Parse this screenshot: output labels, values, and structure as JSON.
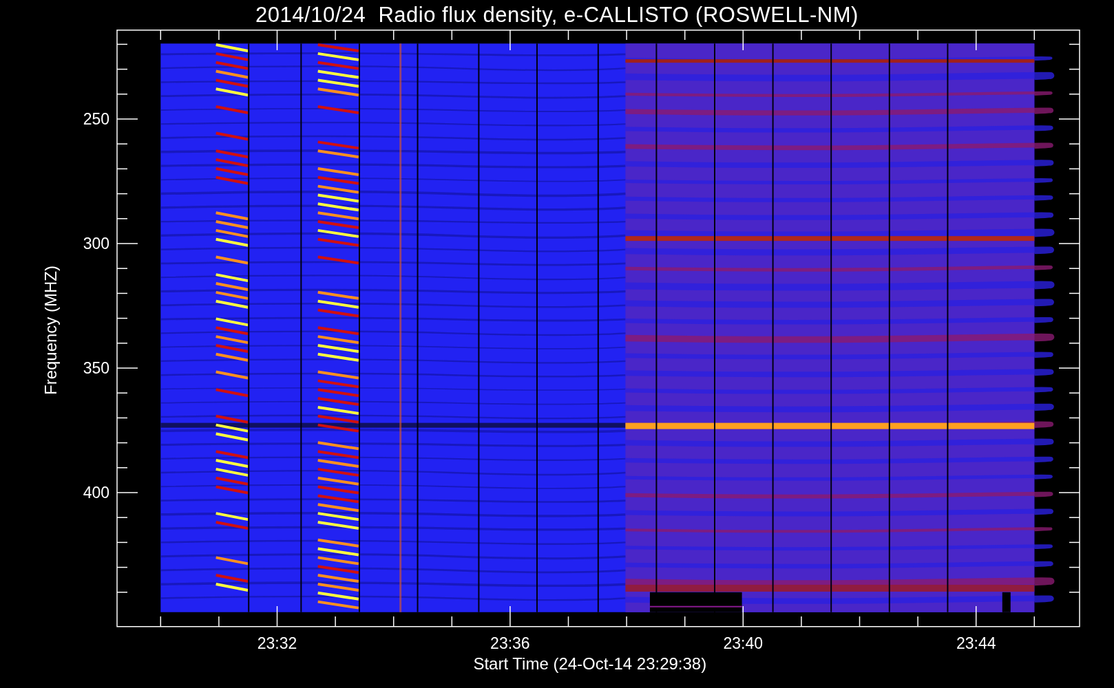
{
  "title": "2014/10/24  Radio flux density, e-CALLISTO (ROSWELL-NM)",
  "y_axis": {
    "label": "Frequency (MHZ)",
    "ticks": [
      "250",
      "300",
      "350",
      "400"
    ]
  },
  "x_axis": {
    "label": "Start Time (24-Oct-14 23:29:38)",
    "ticks": [
      "23:32",
      "23:36",
      "23:40",
      "23:44"
    ]
  }
}
